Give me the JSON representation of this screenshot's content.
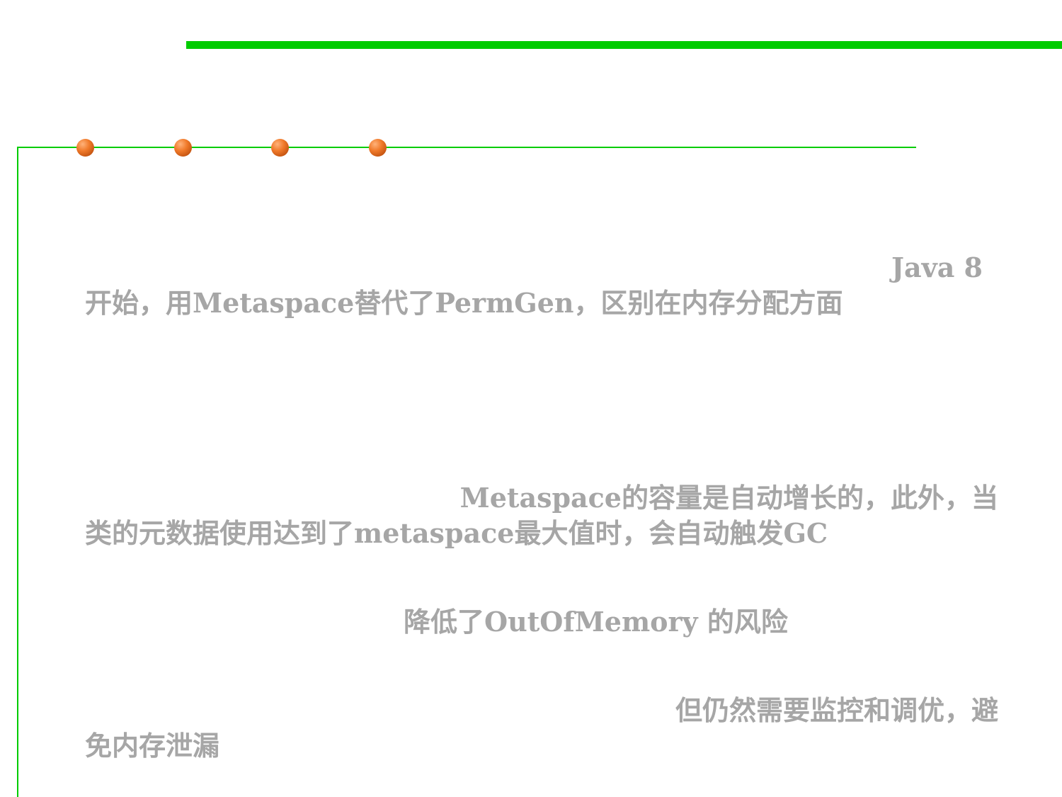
{
  "slide": {
    "paragraphs": [
      {
        "line1": "Java 8",
        "line2": "开始，用Metaspace替代了PermGen，区别在内存分配方面"
      },
      {
        "line1": "Metaspace的容量是自动增长的，此外，当",
        "line2": "类的元数据使用达到了metaspace最大值时，会自动触发GC"
      },
      {
        "line1": "降低了OutOfMemory 的风险"
      },
      {
        "line1": "但仍然需要监控和调优，避",
        "line2": "免内存泄漏"
      }
    ]
  },
  "colors": {
    "accent_green": "#00cc00",
    "dot_orange": "#f07a2a",
    "text_gray": "#a6a6a6"
  }
}
